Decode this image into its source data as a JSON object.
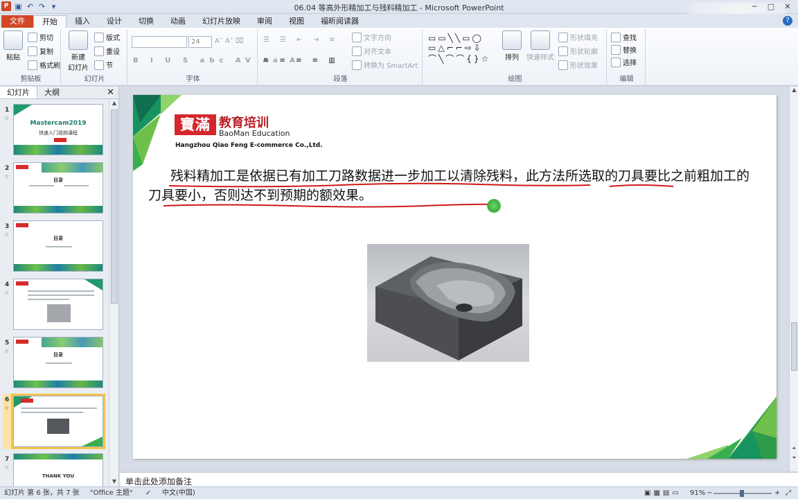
{
  "window": {
    "title": "06.04 等高外形精加工与残料精加工 - Microsoft PowerPoint"
  },
  "tabs": [
    "文件",
    "开始",
    "插入",
    "设计",
    "切换",
    "动画",
    "幻灯片放映",
    "审阅",
    "视图",
    "福昕阅读器"
  ],
  "ribbon": {
    "clipboard": {
      "label": "剪贴板",
      "paste": "粘贴",
      "cut": "剪切",
      "copy": "复制",
      "format_painter": "格式刷"
    },
    "slides": {
      "label": "幻灯片",
      "new_slide_1": "新建",
      "new_slide_2": "幻灯片",
      "layout": "版式",
      "reset": "重设",
      "section": "节"
    },
    "font": {
      "label": "字体",
      "size": "24"
    },
    "paragraph": {
      "label": "段落",
      "text_direction": "文字方向",
      "align_text": "对齐文本",
      "smartart": "转换为 SmartArt"
    },
    "drawing": {
      "label": "绘图",
      "arrange": "排列",
      "quick_styles": "快速样式",
      "shape_fill": "形状填充",
      "shape_outline": "形状轮廓",
      "shape_effects": "形状效果"
    },
    "editing": {
      "label": "编辑",
      "find": "查找",
      "replace": "替换",
      "select": "选择"
    }
  },
  "pane": {
    "tab_slides": "幻灯片",
    "tab_outline": "大纲"
  },
  "thumbnails": [
    {
      "num": "1",
      "text": "Mastercam2019",
      "sub": "快速入门视频课程"
    },
    {
      "num": "2",
      "text": "目录"
    },
    {
      "num": "3",
      "text": "目录"
    },
    {
      "num": "4",
      "text": ""
    },
    {
      "num": "5",
      "text": "目录"
    },
    {
      "num": "6",
      "text": ""
    },
    {
      "num": "7",
      "text": "THANK YOU"
    }
  ],
  "slide": {
    "logo_text": "寶滿",
    "logo_cn": "教育培训",
    "logo_en": "BaoMan Education",
    "logo_sub": "Hangzhou Qiao Feng E-commerce Co.,Ltd.",
    "paragraph": "残料精加工是依据已有加工刀路数据进一步加工以清除残料，此方法所选取的刀具要比之前粗加工的刀具要小，否则达不到预期的额效果。"
  },
  "notes": {
    "placeholder": "单击此处添加备注"
  },
  "status": {
    "slide": "幻灯片 第 6 张，共 7 张",
    "theme": "\"Office 主题\"",
    "lang": "中文(中国)",
    "zoom": "91%"
  },
  "colors": {
    "accent": "#d24726",
    "brand_red": "#d5262c",
    "green": "#3aae4f"
  }
}
